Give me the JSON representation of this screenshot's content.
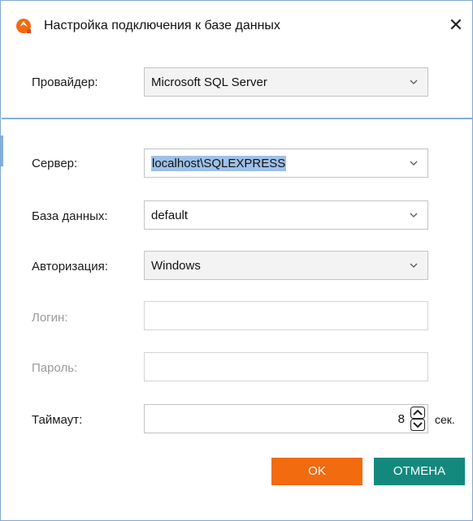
{
  "window": {
    "title": "Настройка подключения к базе данных",
    "close_glyph": "✕",
    "icon": "app-logo-icon"
  },
  "form": {
    "provider": {
      "label": "Провайдер:",
      "value": "Microsoft SQL Server"
    },
    "server": {
      "label": "Сервер:",
      "value": "localhost\\SQLEXPRESS",
      "selected": true
    },
    "database": {
      "label": "База данных:",
      "value": "default"
    },
    "auth": {
      "label": "Авторизация:",
      "value": "Windows"
    },
    "login": {
      "label": "Логин:",
      "value": "",
      "disabled": true
    },
    "password": {
      "label": "Пароль:",
      "value": "",
      "disabled": true
    },
    "timeout": {
      "label": "Таймаут:",
      "value": "8",
      "unit": "сек."
    }
  },
  "buttons": {
    "ok": "OK",
    "cancel": "ОТМЕНА"
  },
  "colors": {
    "accent": "#7fb1e3",
    "ok": "#f26b0f",
    "cancel": "#13897e",
    "selection": "#9dc1e8"
  }
}
